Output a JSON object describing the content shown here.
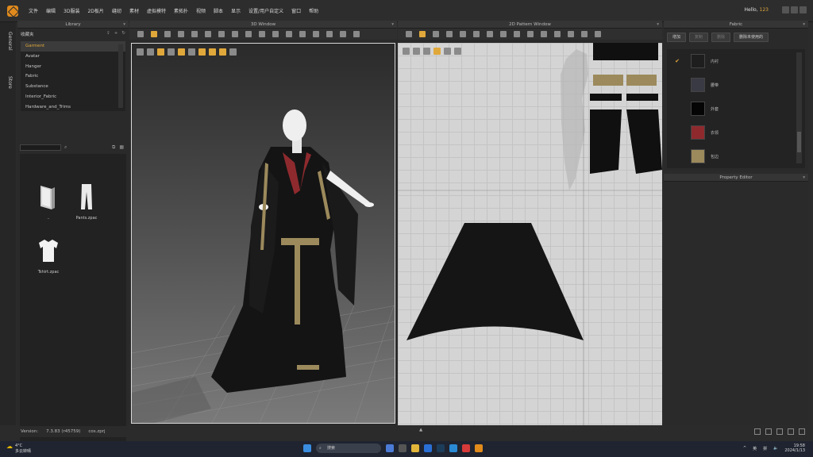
{
  "menu": {
    "items": [
      "文件",
      "编辑",
      "3D服装",
      "2D板片",
      "缝纫",
      "素材",
      "虚拟模特",
      "素拓扑",
      "视频",
      "脚本",
      "显示",
      "设置/用户自定义",
      "窗口",
      "帮助"
    ],
    "hello_prefix": "Hello,",
    "user": "123"
  },
  "left_tabs": [
    "General",
    "Store"
  ],
  "library": {
    "title": "Library",
    "path": "收藏夹",
    "tree": [
      "Garment",
      "Avatar",
      "Hanger",
      "Fabric",
      "Substance",
      "Interior_Fabric",
      "Hardware_and_Trims"
    ],
    "files": [
      {
        "label": "..",
        "icon": "folder-icon"
      },
      {
        "label": "Pants.zpac",
        "icon": "pants-icon"
      },
      {
        "label": "Tshirt.zpac",
        "icon": "tshirt-icon"
      }
    ]
  },
  "window_3d": {
    "title": "3D Window"
  },
  "window_2d": {
    "title": "2D Pattern Window"
  },
  "fabric": {
    "title": "Fabric",
    "buttons": [
      "增加",
      "复制",
      "删除",
      "删除未使用的"
    ],
    "items": [
      {
        "name": "内衬",
        "color": "#1e1e1e",
        "checked": true
      },
      {
        "name": "腰带",
        "color": "#3a3a44",
        "checked": false
      },
      {
        "name": "外套",
        "color": "#050505",
        "checked": false
      },
      {
        "name": "衣领",
        "color": "#8e2a2e",
        "checked": false
      },
      {
        "name": "包边",
        "color": "#9c8a5c",
        "checked": false
      }
    ]
  },
  "property_editor": {
    "title": "Property Editor"
  },
  "status": {
    "version_label": "Version:",
    "version": "7.3.83 (r45759)",
    "file": "cos.zprj"
  },
  "taskbar": {
    "temperature": "4°C",
    "weather": "多云转晴",
    "search_placeholder": "搜索",
    "ime1": "英",
    "ime2": "拼",
    "time": "19:58",
    "date": "2024/1/13"
  },
  "colors": {
    "accent": "#e0a83a",
    "garment_red": "#8e2a2e",
    "garment_gold": "#9c8a5c"
  }
}
